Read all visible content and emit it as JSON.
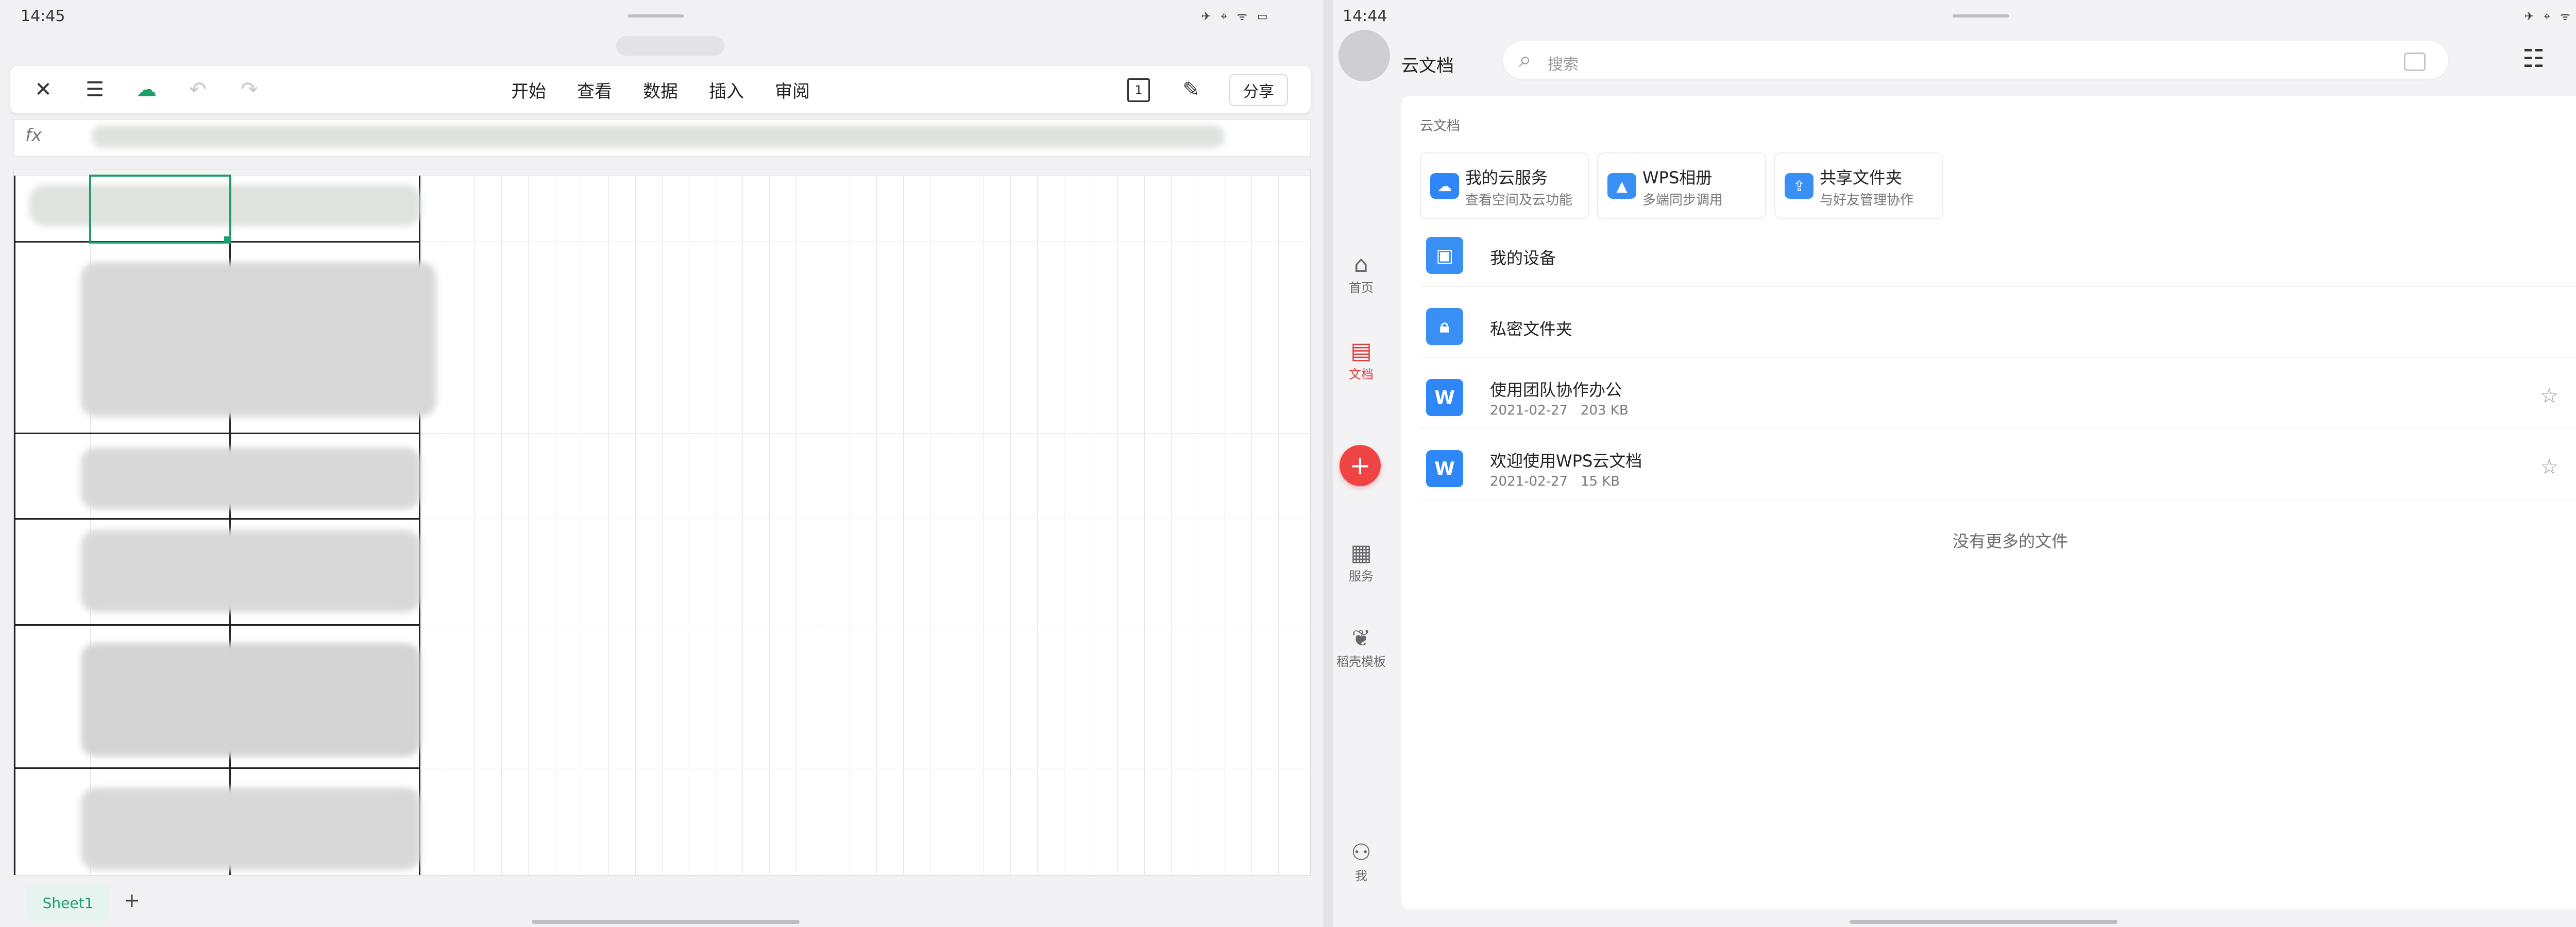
{
  "left_app": {
    "status": {
      "time": "14:45"
    },
    "toolbar": {
      "menu": [
        "开始",
        "查看",
        "数据",
        "插入",
        "审阅"
      ],
      "page_num": "1",
      "share": "分享"
    },
    "formula_bar": {
      "fx": "fx"
    },
    "sheet": {
      "tab": "Sheet1",
      "add": "+"
    }
  },
  "right_app": {
    "status": {
      "time": "14:44"
    },
    "title": "云文档",
    "search": {
      "placeholder": "搜索"
    },
    "sidebar": [
      {
        "label": "首页",
        "icon": "home-icon"
      },
      {
        "label": "文档",
        "icon": "document-icon"
      },
      {
        "label": "服务",
        "icon": "grid-icon"
      },
      {
        "label": "稻壳模板",
        "icon": "leaf-icon"
      },
      {
        "label": "我",
        "icon": "user-icon"
      }
    ],
    "section_label": "云文档",
    "quick_access": [
      {
        "title": "我的云服务",
        "subtitle": "查看空间及云功能",
        "icon": "cloud-icon",
        "color": "#2f86f6"
      },
      {
        "title": "WPS相册",
        "subtitle": "多端同步调用",
        "icon": "photo-icon",
        "color": "#3a8ff5"
      },
      {
        "title": "共享文件夹",
        "subtitle": "与好友管理协作",
        "icon": "share-icon",
        "color": "#3a8ff5"
      }
    ],
    "folders": [
      {
        "name": "我的设备",
        "icon": "device-folder-icon"
      },
      {
        "name": "私密文件夹",
        "icon": "lock-folder-icon"
      }
    ],
    "files": [
      {
        "name": "使用团队协作办公",
        "date": "2021-02-27",
        "size": "203 KB"
      },
      {
        "name": "欢迎使用WPS云文档",
        "date": "2021-02-27",
        "size": "15 KB"
      }
    ],
    "no_more": "没有更多的文件",
    "colors": {
      "accent": "#ee4444",
      "file_blue": "#2f86f6",
      "selection_green": "#1f9d6b"
    }
  }
}
